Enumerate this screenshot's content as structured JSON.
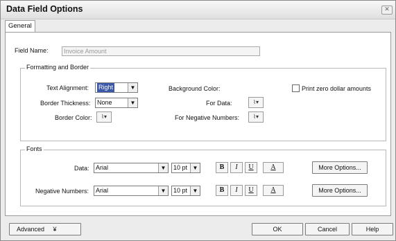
{
  "window": {
    "title": "Data Field Options",
    "close_glyph": "✕"
  },
  "tabs": [
    {
      "label": "General"
    }
  ],
  "field_name": {
    "label": "Field Name:",
    "value": "Invoice Amount"
  },
  "formatting": {
    "legend": "Formatting and Border",
    "text_alignment": {
      "label": "Text Alignment:",
      "value": "Right"
    },
    "border_thickness": {
      "label": "Border Thickness:",
      "value": "None"
    },
    "border_color": {
      "label": "Border Color:"
    },
    "background_color": {
      "label": "Background Color:"
    },
    "for_data": {
      "label": "For Data:"
    },
    "for_negative": {
      "label": "For Negative Numbers:"
    },
    "print_zero": {
      "label": "Print zero dollar amounts",
      "checked": false
    }
  },
  "fonts": {
    "legend": "Fonts",
    "data": {
      "label": "Data:",
      "font": "Arial",
      "size": "10 pt",
      "more_options": "More Options..."
    },
    "negative": {
      "label": "Negative Numbers:",
      "font": "Arial",
      "size": "10 pt",
      "more_options": "More Options..."
    },
    "bold": "B",
    "italic": "I",
    "underline": "U",
    "color": "A"
  },
  "footer": {
    "advanced": "Advanced",
    "advanced_glyph": "¥",
    "ok": "OK",
    "cancel": "Cancel",
    "help": "Help"
  },
  "icons": {
    "dropdown": "▼",
    "paint": "⌇▾"
  }
}
